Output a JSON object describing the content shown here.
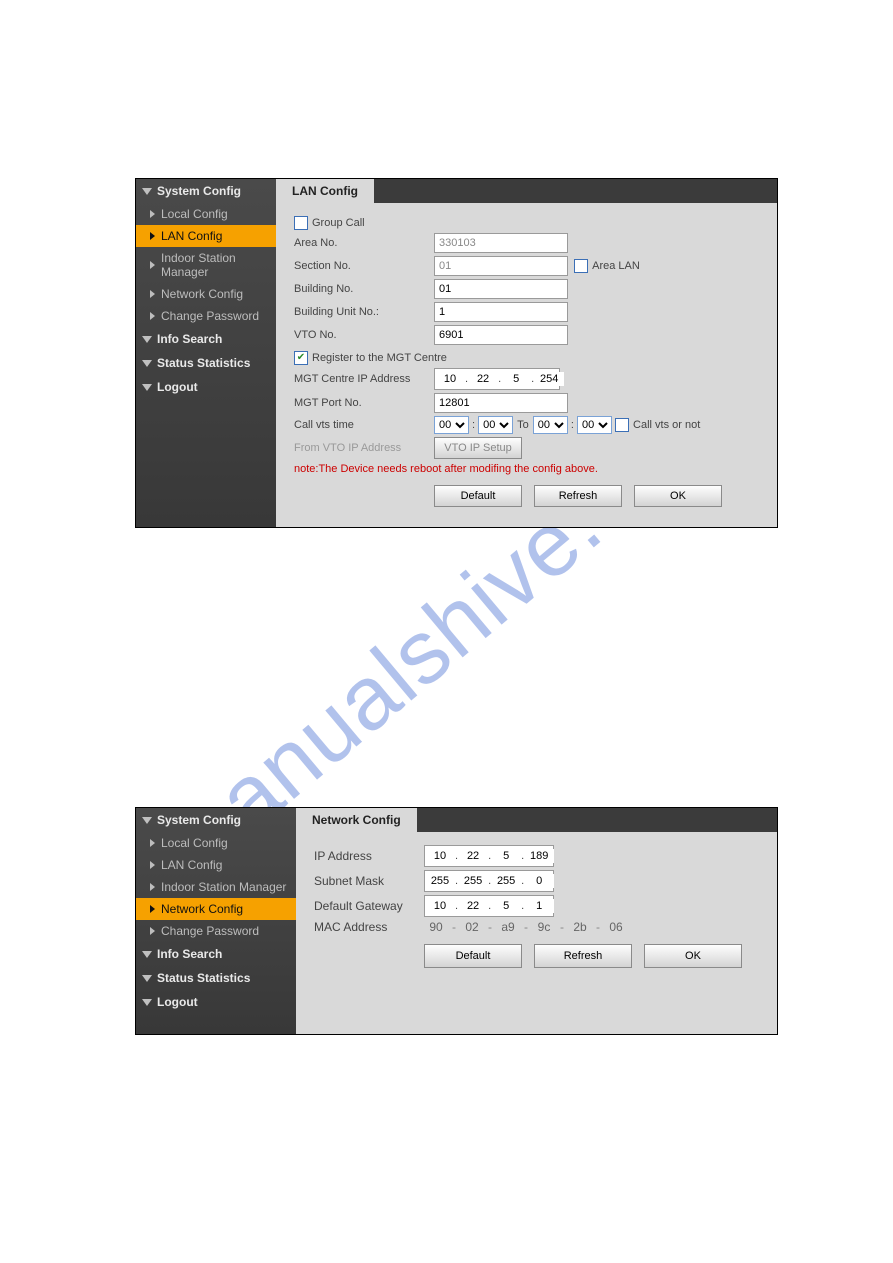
{
  "watermark": "manualshive.com",
  "p1": {
    "sidebar": {
      "header": "System Config",
      "items": [
        "Local Config",
        "LAN Config",
        "Indoor Station Manager",
        "Network Config",
        "Change Password"
      ],
      "headers": [
        "System Config",
        "Info Search",
        "Status Statistics",
        "Logout"
      ]
    },
    "tab": "LAN Config",
    "form": {
      "group_call_label": "Group Call",
      "area_no_label": "Area No.",
      "area_no": "330103",
      "section_no_label": "Section No.",
      "section_no": "01",
      "area_lan_label": "Area LAN",
      "building_no_label": "Building No.",
      "building_no": "01",
      "building_unit_no_label": "Building Unit No.:",
      "building_unit_no": "1",
      "vto_no_label": "VTO No.",
      "vto_no": "6901",
      "register_mgt_label": "Register to the MGT Centre",
      "mgt_ip_label": "MGT Centre IP Address",
      "mgt_ip": [
        "10",
        "22",
        "5",
        "254"
      ],
      "mgt_port_label": "MGT Port No.",
      "mgt_port": "12801",
      "call_vts_time_label": "Call vts time",
      "time": {
        "hh1": "00",
        "mm1": "00",
        "hh2": "00",
        "mm2": "00"
      },
      "to_label": "To",
      "call_vts_or_not_label": "Call vts or not",
      "from_vto_ip_label": "From VTO IP Address",
      "vto_ip_setup_label": "VTO IP Setup",
      "note": "note:The Device needs reboot after modifing the config above."
    },
    "buttons": {
      "default": "Default",
      "refresh": "Refresh",
      "ok": "OK"
    }
  },
  "p2": {
    "sidebar": {
      "header": "System Config",
      "items": [
        "Local Config",
        "LAN Config",
        "Indoor Station Manager",
        "Network Config",
        "Change Password"
      ],
      "headers": [
        "System Config",
        "Info Search",
        "Status Statistics",
        "Logout"
      ]
    },
    "tab": "Network Config",
    "form": {
      "ip_label": "IP Address",
      "ip": [
        "10",
        "22",
        "5",
        "189"
      ],
      "mask_label": "Subnet Mask",
      "mask": [
        "255",
        "255",
        "255",
        "0"
      ],
      "gw_label": "Default Gateway",
      "gw": [
        "10",
        "22",
        "5",
        "1"
      ],
      "mac_label": "MAC Address",
      "mac": [
        "90",
        "02",
        "a9",
        "9c",
        "2b",
        "06"
      ]
    },
    "buttons": {
      "default": "Default",
      "refresh": "Refresh",
      "ok": "OK"
    }
  }
}
